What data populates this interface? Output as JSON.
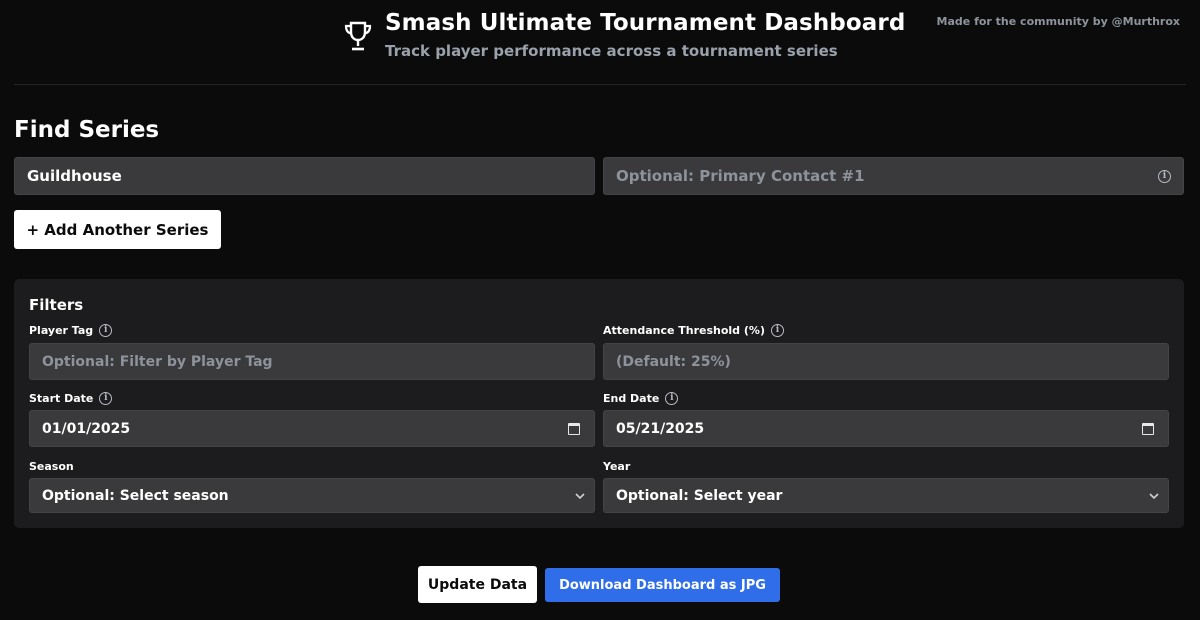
{
  "header": {
    "title": "Smash Ultimate Tournament Dashboard",
    "subtitle": "Track player performance across a tournament series",
    "credit": "Made for the community by @Murthrox",
    "icon": "trophy-icon"
  },
  "find_series": {
    "title": "Find Series",
    "series_name_value": "Guildhouse",
    "contact_placeholder": "Optional: Primary Contact #1",
    "add_button_label": "+ Add Another Series"
  },
  "filters": {
    "title": "Filters",
    "player_tag_label": "Player Tag",
    "player_tag_placeholder": "Optional: Filter by Player Tag",
    "attendance_label": "Attendance Threshold (%)",
    "attendance_placeholder": "(Default: 25%)",
    "start_date_label": "Start Date",
    "start_date_value": "01/01/2025",
    "end_date_label": "End Date",
    "end_date_value": "05/21/2025",
    "season_label": "Season",
    "season_value": "Optional: Select season",
    "year_label": "Year",
    "year_value": "Optional: Select year"
  },
  "actions": {
    "update_label": "Update Data",
    "download_label": "Download Dashboard as JPG"
  },
  "colors": {
    "background": "#0b0b0c",
    "panel": "#1c1c1e",
    "input": "#3a3a3c",
    "accent_blue": "#2f6ee8"
  }
}
